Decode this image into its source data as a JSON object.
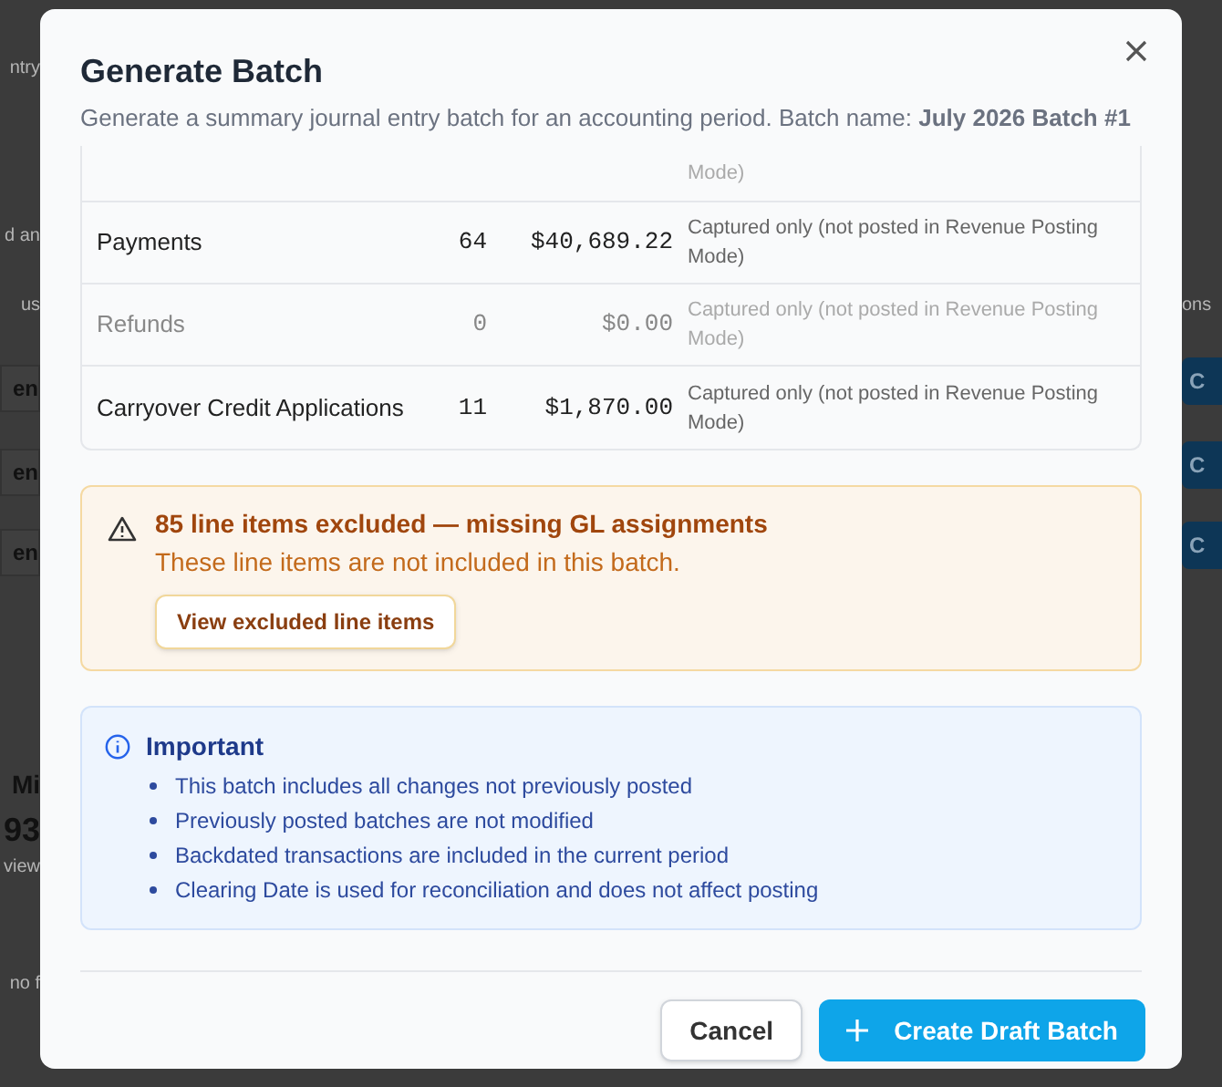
{
  "background": {
    "left": [
      {
        "text": "ntry",
        "kind": "text"
      },
      {
        "text": "d an",
        "kind": "text"
      },
      {
        "text": "us",
        "kind": "text"
      },
      {
        "text": "en",
        "kind": "button"
      },
      {
        "text": "en",
        "kind": "button"
      },
      {
        "text": "en",
        "kind": "button"
      },
      {
        "text": "Mi",
        "kind": "bold"
      },
      {
        "text": "93",
        "kind": "big"
      },
      {
        "text": "view",
        "kind": "text"
      },
      {
        "text": "no f",
        "kind": "text"
      }
    ],
    "right": [
      {
        "text": "ons",
        "kind": "text"
      },
      {
        "text": "C",
        "kind": "button"
      },
      {
        "text": "C",
        "kind": "button"
      },
      {
        "text": "C",
        "kind": "button"
      }
    ]
  },
  "dialog": {
    "title": "Generate Batch",
    "subtitle": "Generate a summary journal entry batch for an accounting period. Batch name: **July 2026 Batch #1**",
    "rows": [
      {
        "note": "Mode)",
        "muted": true
      },
      {
        "name": "Payments",
        "count": "64",
        "amount": "$40,689.22",
        "note": "Captured only (not posted in Revenue Posting Mode)",
        "muted": false
      },
      {
        "name": "Refunds",
        "count": "0",
        "amount": "$0.00",
        "note": "Captured only (not posted in Revenue Posting Mode)",
        "muted": true
      },
      {
        "name": "Carryover Credit Applications",
        "count": "11",
        "amount": "$1,870.00",
        "note": "Captured only (not posted in Revenue Posting Mode)",
        "muted": false
      }
    ],
    "warning": {
      "title": "85 line items excluded — missing GL assignments",
      "message": "These line items are not included in this batch.",
      "button": "View excluded line items"
    },
    "info": {
      "title": "Important",
      "items": [
        "This batch includes all changes not previously posted",
        "Previously posted batches are not modified",
        "Backdated transactions are included in the current period",
        "Clearing Date is used for reconciliation and does not affect posting"
      ]
    },
    "buttons": {
      "cancel": "Cancel",
      "create": "Create Draft Batch"
    }
  }
}
